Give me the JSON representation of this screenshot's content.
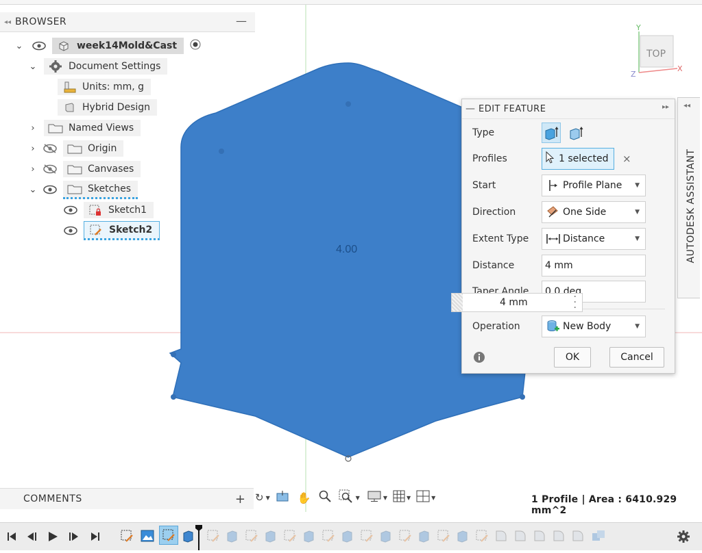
{
  "browser": {
    "title": "BROWSER",
    "collapse_icon": "double-chevron-left-icon",
    "items": [
      {
        "label": "week14Mold&Cast",
        "icon": "component-icon"
      },
      {
        "label": "Document Settings",
        "icon": "gear-icon"
      },
      {
        "label": "Units: mm, g",
        "icon": "ruler-icon"
      },
      {
        "label": "Hybrid Design",
        "icon": "design-icon"
      },
      {
        "label": "Named Views",
        "icon": "folder-icon"
      },
      {
        "label": "Origin",
        "icon": "folder-icon"
      },
      {
        "label": "Canvases",
        "icon": "folder-icon"
      },
      {
        "label": "Sketches",
        "icon": "folder-icon"
      },
      {
        "label": "Sketch1",
        "icon": "sketch-locked-icon"
      },
      {
        "label": "Sketch2",
        "icon": "sketch-edit-icon"
      }
    ]
  },
  "viewport": {
    "dimension_label": "4.00",
    "profile_color": "#3d7fc9",
    "view_cube_label": "TOP",
    "axis_x": "X",
    "axis_y": "Y",
    "axis_z": "Z"
  },
  "edit_feature": {
    "title": "EDIT FEATURE",
    "rows": {
      "type": "Type",
      "profiles": "Profiles",
      "profiles_value": "1 selected",
      "start": "Start",
      "start_value": "Profile Plane",
      "direction": "Direction",
      "direction_value": "One Side",
      "extent_type": "Extent Type",
      "extent_value": "Distance",
      "distance": "Distance",
      "distance_value": "4 mm",
      "taper_angle": "Taper Angle",
      "taper_value": "0.0 deg",
      "operation": "Operation",
      "operation_value": "New Body"
    },
    "ok_label": "OK",
    "cancel_label": "Cancel",
    "floating_value": "4 mm"
  },
  "assistant": {
    "label": "AUTODESK ASSISTANT"
  },
  "comments": {
    "title": "COMMENTS"
  },
  "status": {
    "text": "1 Profile | Area : 6410.929 mm^2"
  },
  "colors": {
    "accent": "#3d7fc9",
    "selection_bg": "#dff1fb",
    "selection_border": "#55aee0",
    "axis_red": "#e88",
    "axis_green": "#8c8"
  }
}
